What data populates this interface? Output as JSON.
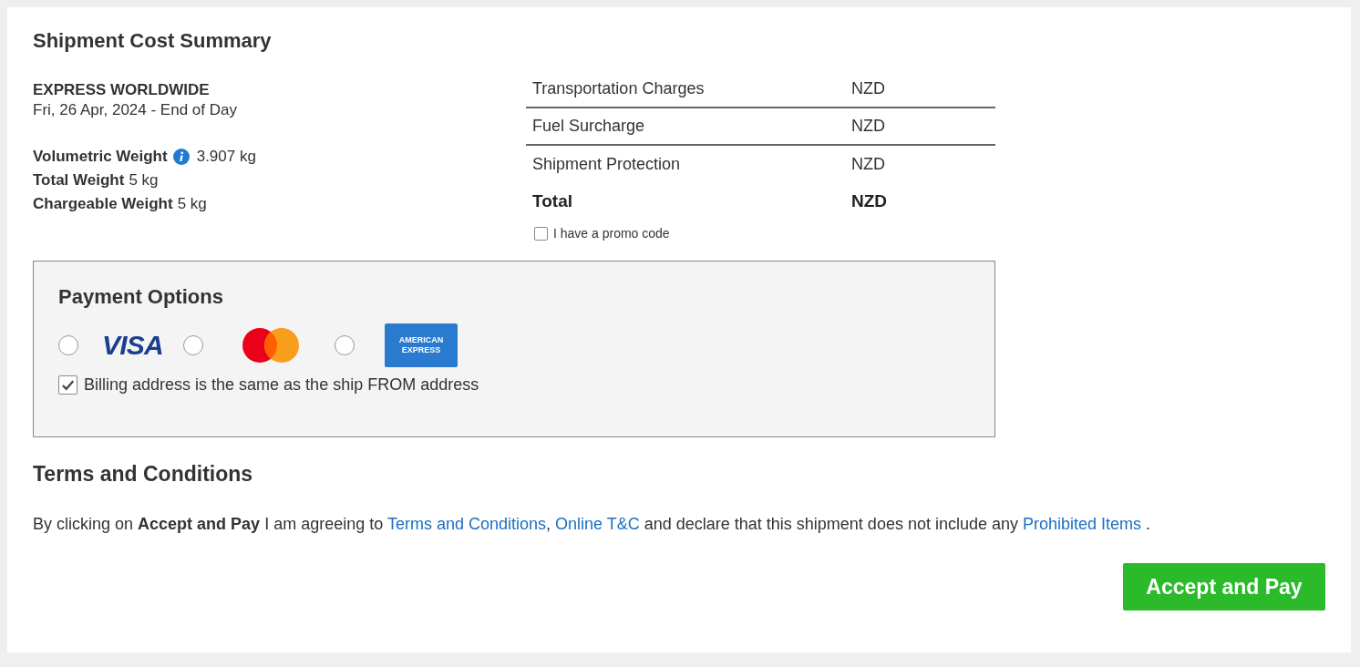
{
  "title": "Shipment Cost Summary",
  "service": {
    "name": "EXPRESS WORLDWIDE",
    "date": "Fri, 26 Apr, 2024 - End of Day"
  },
  "weights": [
    {
      "label": "Volumetric Weight",
      "info": true,
      "value": "3.907 kg"
    },
    {
      "label": "Total Weight",
      "info": false,
      "value": "5 kg"
    },
    {
      "label": "Chargeable Weight",
      "info": false,
      "value": "5 kg"
    }
  ],
  "charges": [
    {
      "label": "Transportation Charges",
      "currency": "NZD",
      "kind": "line"
    },
    {
      "label": "Fuel Surcharge",
      "currency": "NZD",
      "kind": "line"
    },
    {
      "label": "Shipment Protection",
      "currency": "NZD",
      "kind": "line"
    },
    {
      "label": "Total",
      "currency": "NZD",
      "kind": "total"
    }
  ],
  "promo": {
    "label": "I have a promo code",
    "checked": false
  },
  "payment": {
    "title": "Payment Options",
    "methods": [
      {
        "kind": "visa",
        "logo_text": "VISA",
        "selected": false
      },
      {
        "kind": "mastercard",
        "selected": false
      },
      {
        "kind": "amex",
        "logo_text": "AMERICAN EXPRESS",
        "selected": false
      }
    ],
    "billing": {
      "label": "Billing address is the same as the ship FROM address",
      "checked": true
    }
  },
  "terms": {
    "title": "Terms and Conditions",
    "parts": [
      {
        "kind": "text",
        "text": "By clicking on **Accept and Pay** I am agreeing to "
      },
      {
        "kind": "link",
        "text": "Terms and Conditions"
      },
      {
        "kind": "text",
        "text": ", "
      },
      {
        "kind": "link",
        "text": "Online T&C"
      },
      {
        "kind": "text",
        "text": " and declare that this shipment does not include any "
      },
      {
        "kind": "link",
        "text": "Prohibited Items"
      },
      {
        "kind": "text",
        "text": " ."
      }
    ]
  },
  "button": "Accept and Pay"
}
